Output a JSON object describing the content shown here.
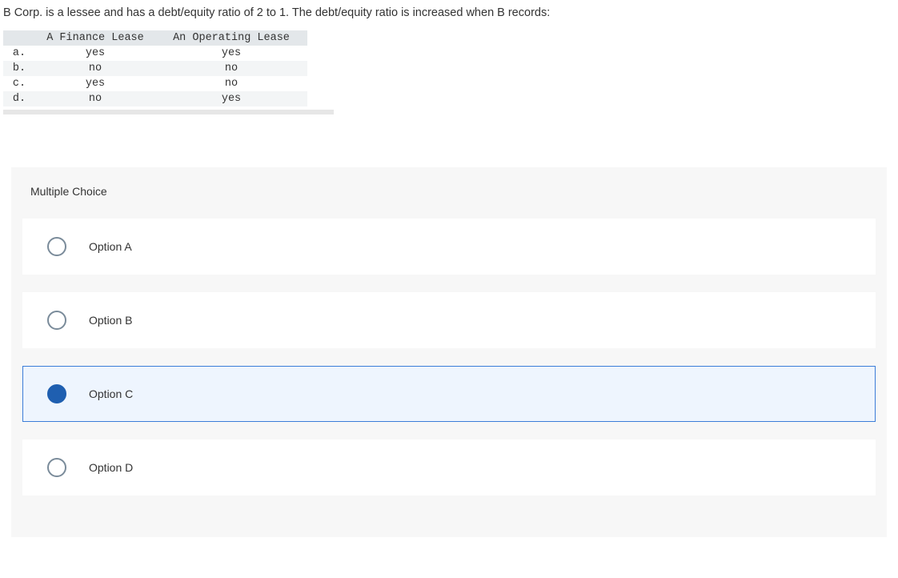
{
  "question": "B Corp. is a lessee and has a debt/equity ratio of 2 to 1. The debt/equity ratio is increased when B records:",
  "table": {
    "headers": {
      "finance": "A Finance Lease",
      "operating": "An Operating Lease"
    },
    "rows": [
      {
        "label": "a.",
        "finance": "yes",
        "operating": "yes"
      },
      {
        "label": "b.",
        "finance": "no",
        "operating": "no"
      },
      {
        "label": "c.",
        "finance": "yes",
        "operating": "no"
      },
      {
        "label": "d.",
        "finance": "no",
        "operating": "yes"
      }
    ]
  },
  "mc": {
    "title": "Multiple Choice",
    "options": [
      {
        "label": "Option A",
        "selected": false
      },
      {
        "label": "Option B",
        "selected": false
      },
      {
        "label": "Option C",
        "selected": true
      },
      {
        "label": "Option D",
        "selected": false
      }
    ]
  }
}
